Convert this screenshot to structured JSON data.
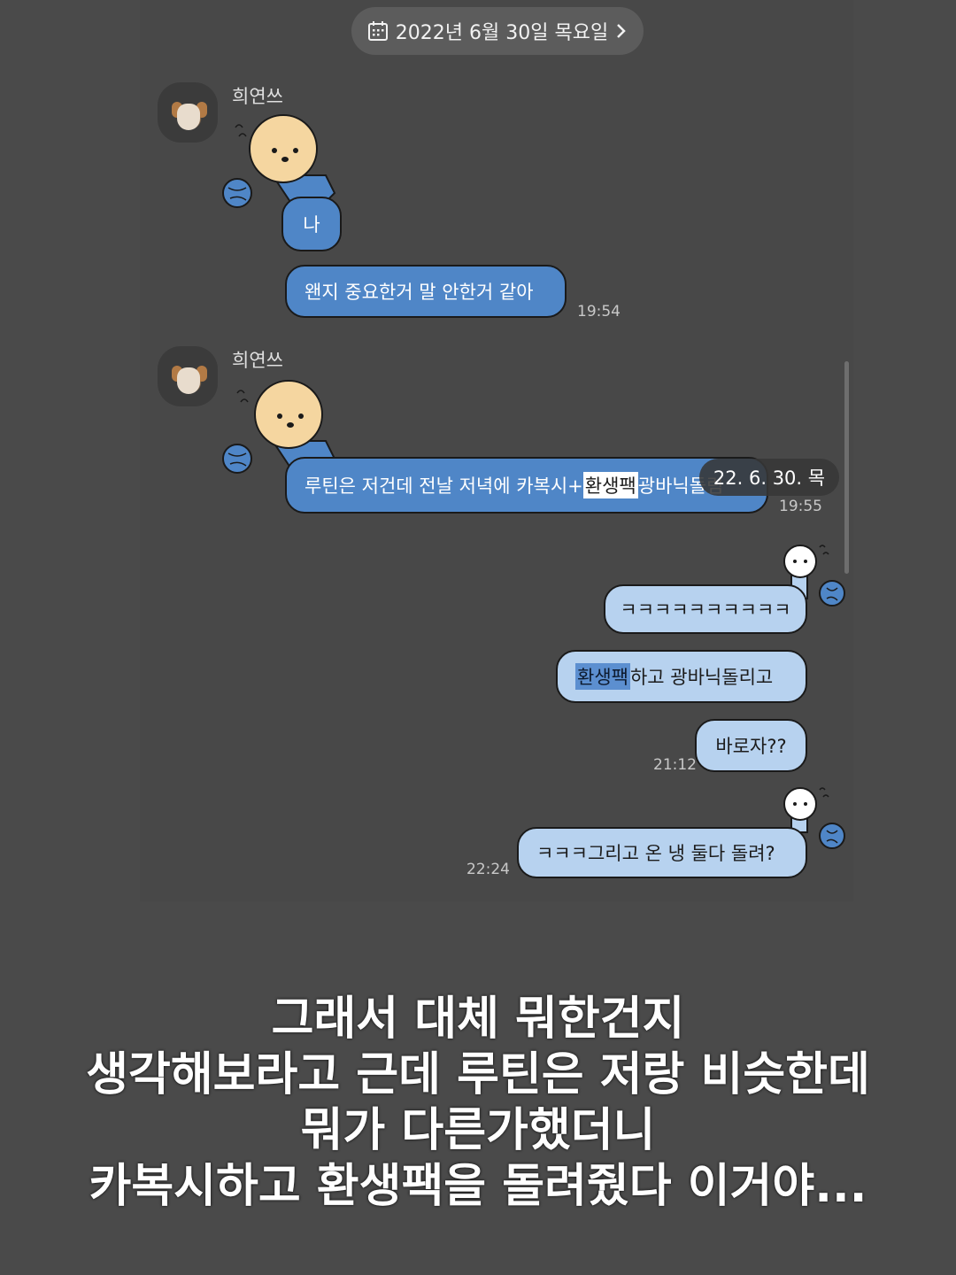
{
  "date_header": {
    "label": "2022년 6월 30일 목요일"
  },
  "messages": [
    {
      "sender": "희연쓰",
      "sticker_text": "나",
      "text": "왠지 중요한거 말 안한거 같아",
      "time": "19:54"
    },
    {
      "sender": "희연쓰",
      "text_before": "루틴은 저건데 전날 저녁에 카복시+",
      "highlight": "환생팩",
      "text_after": " 광바닉돌림",
      "time": "19:55"
    }
  ],
  "date_tooltip": "22. 6. 30. 목",
  "my_messages": [
    {
      "text": "ㅋㅋㅋㅋㅋㅋㅋㅋㅋㅋ"
    },
    {
      "highlight": "환생팩",
      "text_after": " 하고 광바닉돌리고"
    },
    {
      "text": "바로자??",
      "time": "21:12"
    },
    {
      "text": "ㅋㅋㅋ그리고 온 냉 둘다 돌려?",
      "time": "22:24"
    }
  ],
  "caption": [
    "그래서 대체 뭐한건지",
    "생각해보라고 근데 루틴은 저랑 비슷한데",
    "뭐가 다른가했더니",
    "카복시하고 환생팩을 돌려줬다 이거야..."
  ],
  "colors": {
    "background": "#4a4a4a",
    "left_bubble": "#4f86c7",
    "right_bubble": "#b7d2ef",
    "date_pill": "#5c5c5c"
  },
  "icons": {
    "date_header": "calendar-icon",
    "date_header_arrow": "chevron-right-icon"
  }
}
